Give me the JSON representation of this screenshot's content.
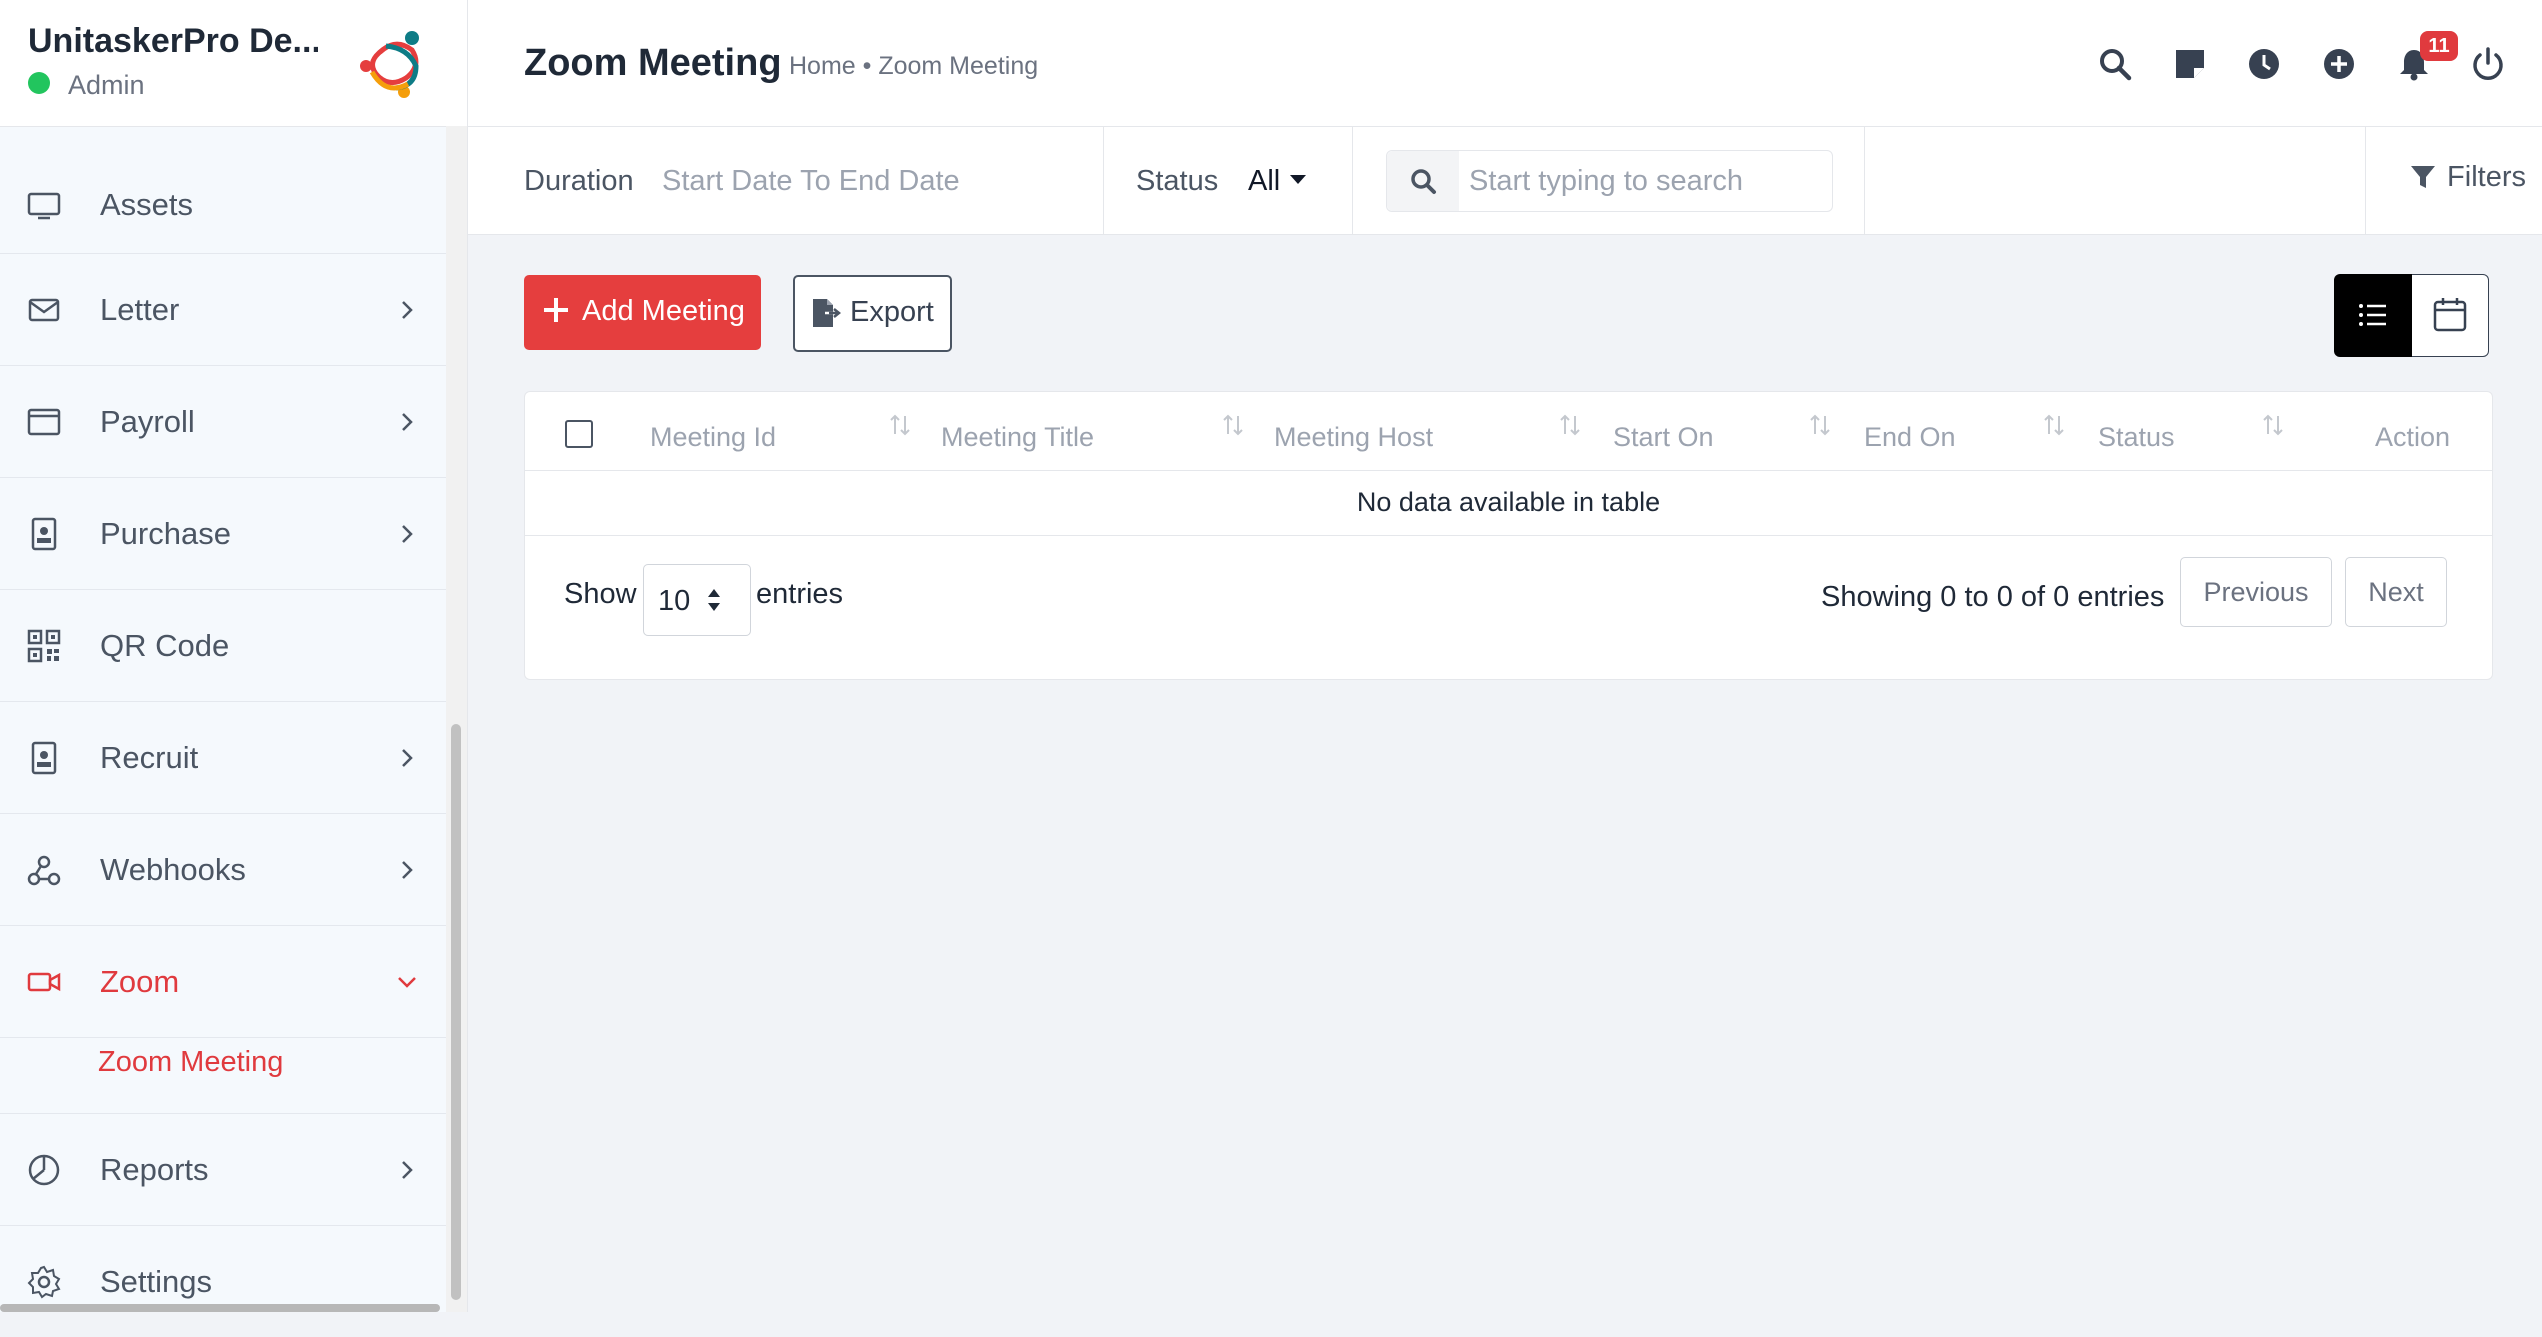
{
  "brand": {
    "name": "UnitaskerPro De...",
    "role": "Admin",
    "status_color": "#22c55e",
    "accent": "#e03a3e"
  },
  "sidebar": {
    "items": [
      {
        "label": "Assets",
        "icon": "monitor-icon",
        "chevron": false
      },
      {
        "label": "Letter",
        "icon": "envelope-icon",
        "chevron": true
      },
      {
        "label": "Payroll",
        "icon": "payroll-card-icon",
        "chevron": true
      },
      {
        "label": "Purchase",
        "icon": "purchase-id-icon",
        "chevron": true
      },
      {
        "label": "QR Code",
        "icon": "qr-code-icon",
        "chevron": false
      },
      {
        "label": "Recruit",
        "icon": "recruit-id-icon",
        "chevron": true
      },
      {
        "label": "Webhooks",
        "icon": "webhooks-icon",
        "chevron": true
      },
      {
        "label": "Zoom",
        "icon": "video-camera-icon",
        "chevron": true,
        "active": true
      },
      {
        "label": "Reports",
        "icon": "pie-chart-icon",
        "chevron": true
      },
      {
        "label": "Settings",
        "icon": "gear-icon",
        "chevron": false
      }
    ],
    "submenu": {
      "label": "Zoom Meeting"
    }
  },
  "header": {
    "title": "Zoom Meeting",
    "breadcrumb": "Home • Zoom Meeting",
    "notification_count": "11",
    "icons": [
      "search-icon",
      "sticky-note-icon",
      "clock-icon",
      "plus-circle-icon",
      "bell-icon",
      "power-icon"
    ]
  },
  "filters": {
    "duration_label": "Duration",
    "date_placeholder": "Start Date To End Date",
    "status_label": "Status",
    "status_value": "All",
    "search_placeholder": "Start typing to search",
    "filters_label": "Filters"
  },
  "actions": {
    "add_label": "Add Meeting",
    "export_label": "Export"
  },
  "table": {
    "columns": [
      "Meeting Id",
      "Meeting Title",
      "Meeting Host",
      "Start On",
      "End On",
      "Status",
      "Action"
    ],
    "empty_message": "No data available in table",
    "show_label": "Show",
    "entries_value": "10",
    "entries_label": "entries",
    "info": "Showing 0 to 0 of 0 entries",
    "prev_label": "Previous",
    "next_label": "Next"
  }
}
